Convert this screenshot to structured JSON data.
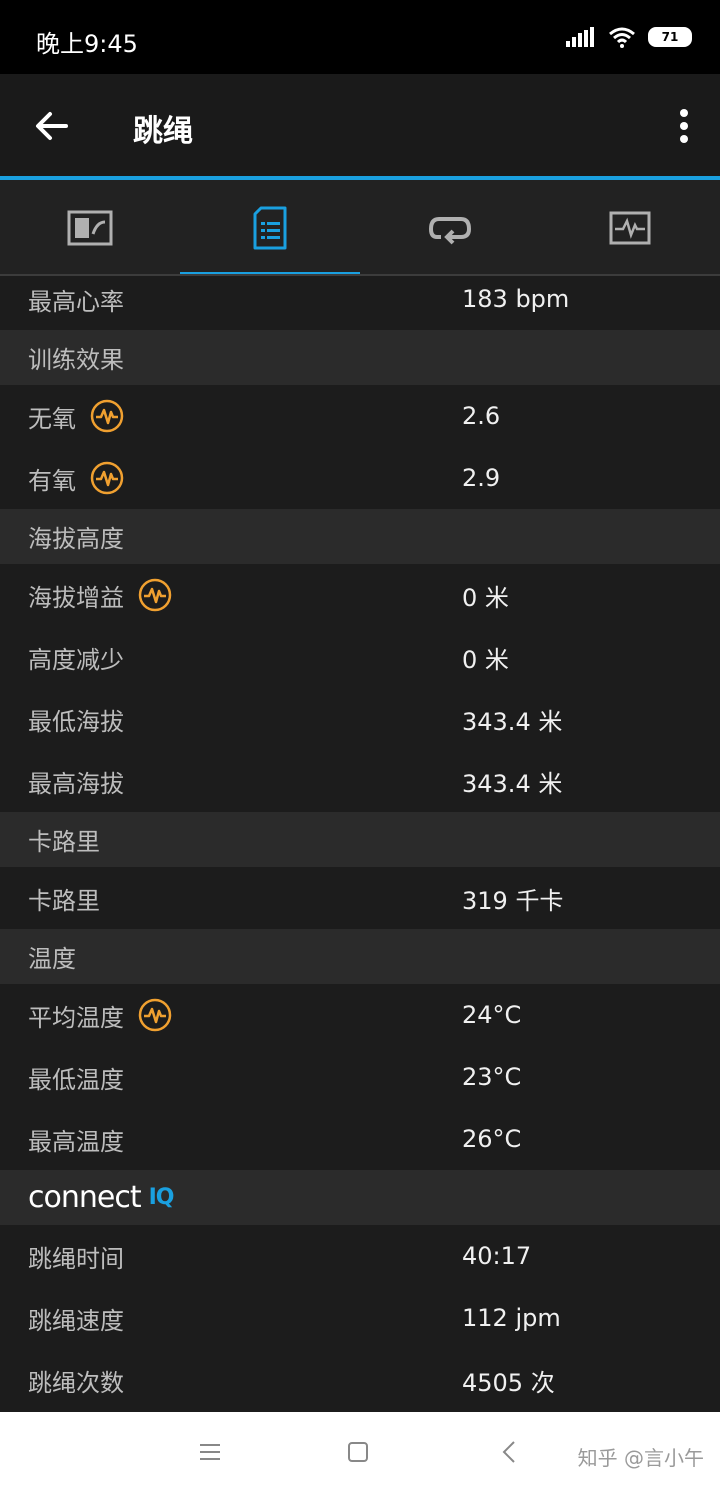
{
  "status": {
    "time": "晚上9:45",
    "battery": "71"
  },
  "header": {
    "title": "跳绳"
  },
  "tabs": [
    {
      "icon": "dashboard-icon"
    },
    {
      "icon": "document-list-icon",
      "active": true
    },
    {
      "icon": "loop-icon"
    },
    {
      "icon": "activity-chart-icon"
    }
  ],
  "content": {
    "max_hr": {
      "label": "最高心率",
      "value": "183 bpm"
    },
    "sections": {
      "training": "训练效果",
      "elevation": "海拔高度",
      "calories": "卡路里",
      "temperature": "温度"
    },
    "anaerobic": {
      "label": "无氧",
      "value": "2.6"
    },
    "aerobic": {
      "label": "有氧",
      "value": "2.9"
    },
    "elev_gain": {
      "label": "海拔增益",
      "value": "0 米"
    },
    "elev_loss": {
      "label": "高度减少",
      "value": "0 米"
    },
    "min_elev": {
      "label": "最低海拔",
      "value": "343.4 米"
    },
    "max_elev": {
      "label": "最高海拔",
      "value": "343.4 米"
    },
    "calories_row": {
      "label": "卡路里",
      "value": "319 千卡"
    },
    "avg_temp": {
      "label": "平均温度",
      "value": "24°C"
    },
    "min_temp": {
      "label": "最低温度",
      "value": "23°C"
    },
    "max_temp": {
      "label": "最高温度",
      "value": "26°C"
    },
    "connect": {
      "brand": "connect",
      "iq": "IQ"
    },
    "jump_time": {
      "label": "跳绳时间",
      "value": "40:17"
    },
    "jump_speed": {
      "label": "跳绳速度",
      "value": "112 jpm"
    },
    "jump_count": {
      "label": "跳绳次数",
      "value": "4505 次"
    }
  },
  "watermark": "知乎 @言小午",
  "colors": {
    "accent": "#1aa0e0",
    "effect_icon": "#f0a030"
  }
}
